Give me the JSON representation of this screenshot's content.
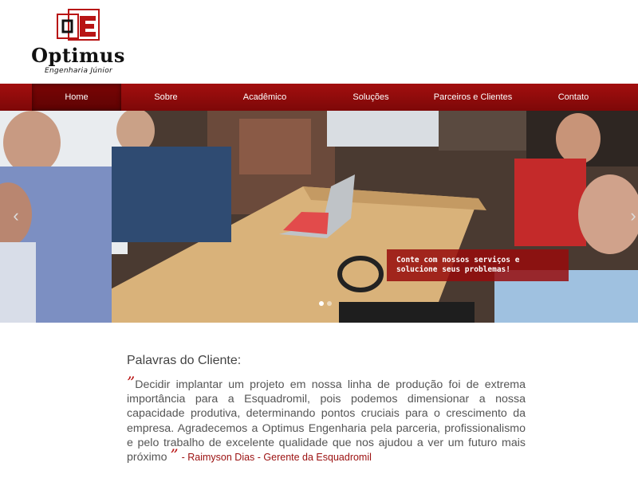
{
  "brand": {
    "name": "Optimus",
    "subtitle": "Engenharia Júnior",
    "colors": {
      "primary": "#a30f0f",
      "primary_dark": "#7d0808",
      "accent_text": "#9b1010"
    }
  },
  "nav": {
    "items": [
      {
        "label": "Home",
        "active": true
      },
      {
        "label": "Sobre",
        "active": false
      },
      {
        "label": "Acadêmico",
        "active": false
      },
      {
        "label": "Soluções",
        "active": false
      },
      {
        "label": "Parceiros e Clientes",
        "active": false
      },
      {
        "label": "Contato",
        "active": false
      }
    ]
  },
  "hero": {
    "caption": "Conte com nossos serviços e solucione seus problemas!",
    "prev_icon": "chevron-left-icon",
    "next_icon": "chevron-right-icon",
    "slides_count": 2,
    "active_slide": 1
  },
  "testimonial": {
    "heading": "Palavras do Cliente:",
    "quote": "Decidir implantar um projeto em nossa linha de produção foi de extrema importância para a Esquadromil, pois podemos dimensionar a nossa capacidade produtiva, determinando pontos cruciais para o crescimento da empresa. Agradecemos a Optimus Engenharia pela parceria, profissionalismo e pelo trabalho de excelente qualidade que nos ajudou a ver um futuro mais próximo",
    "open_mark": "”",
    "close_mark": "”",
    "author": "- Raimyson Dias - Gerente da Esquadromil"
  }
}
